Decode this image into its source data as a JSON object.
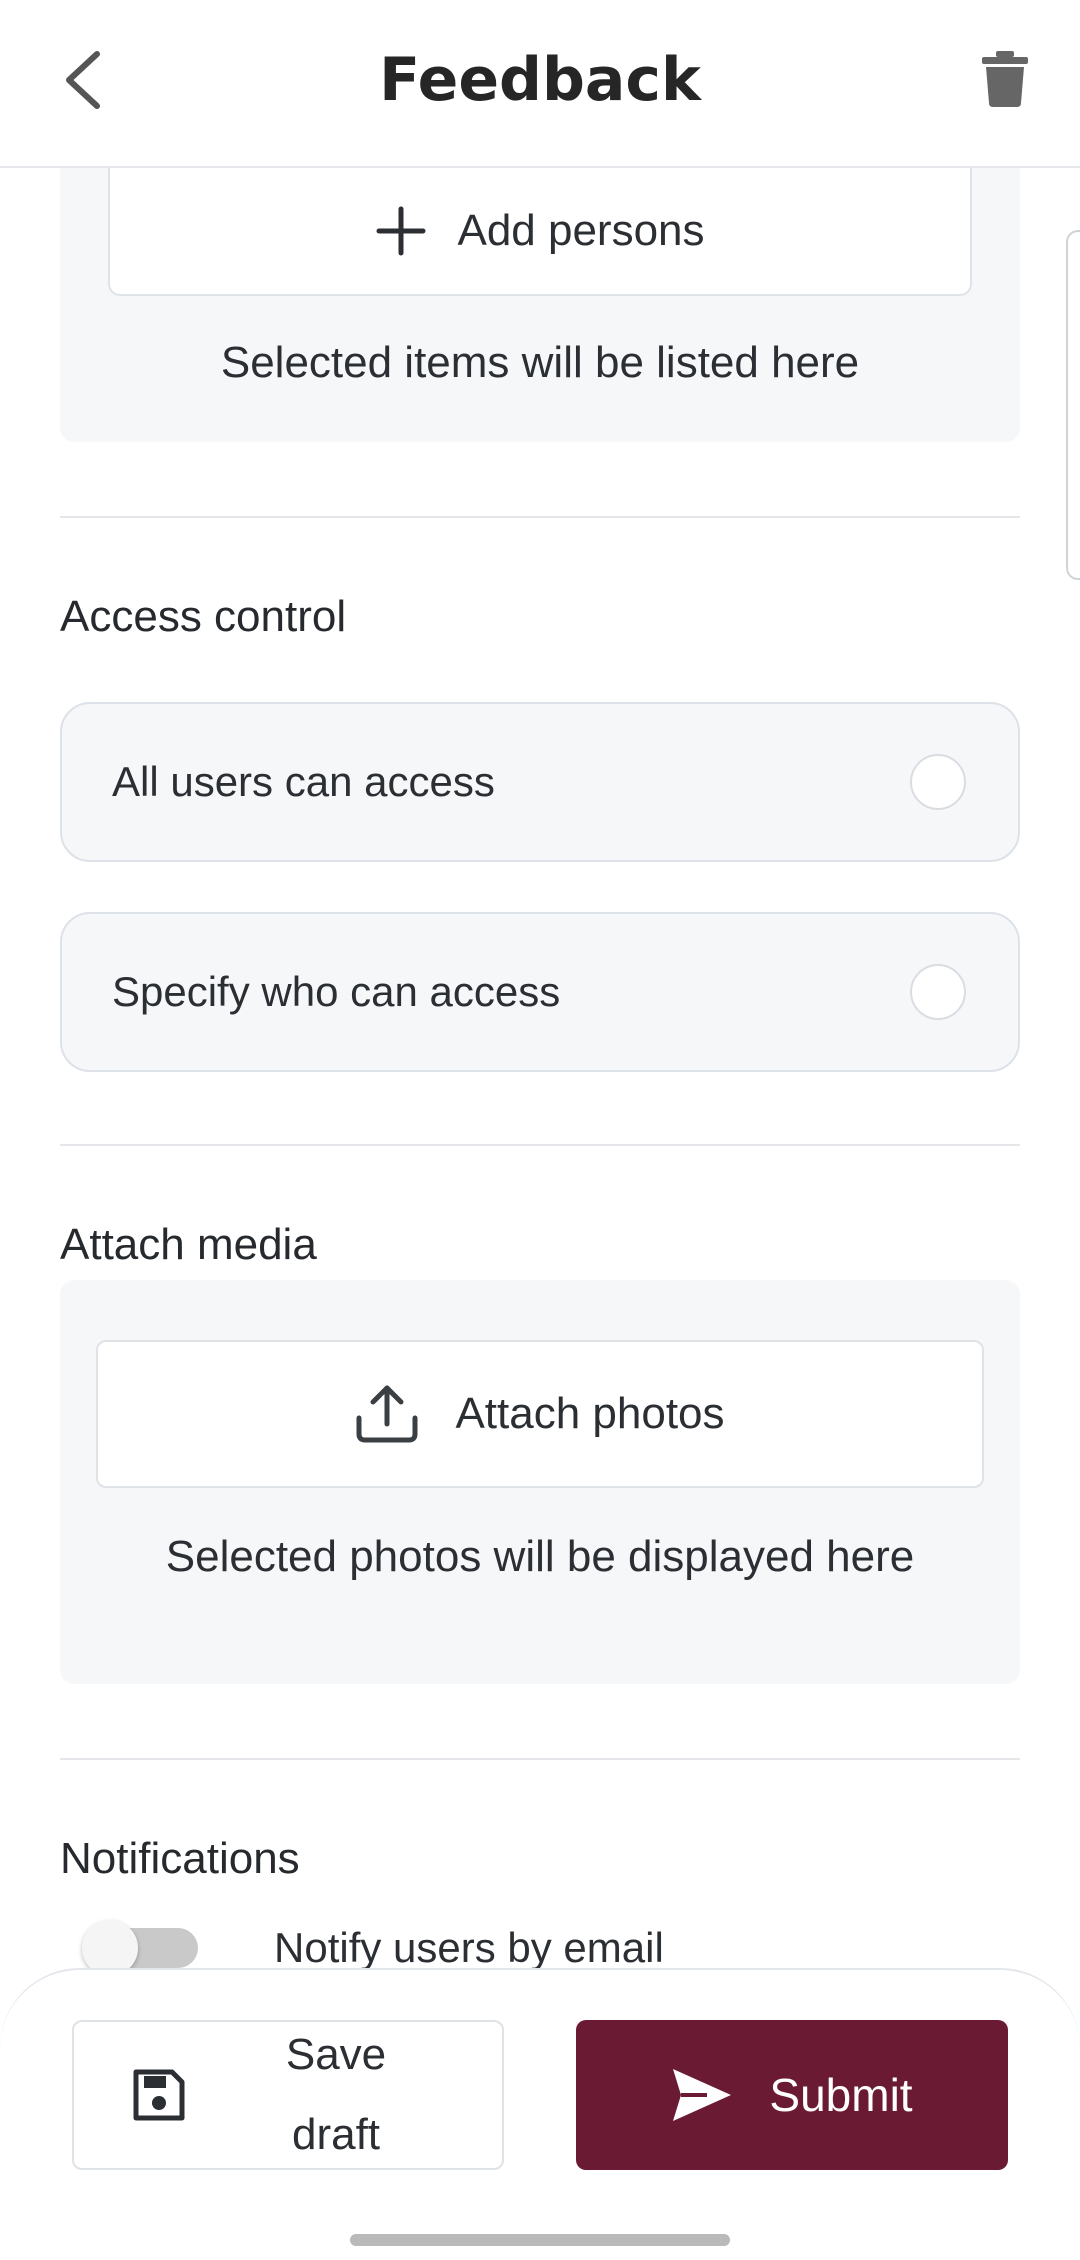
{
  "header": {
    "title": "Feedback"
  },
  "persons": {
    "add_label": "Add persons",
    "placeholder": "Selected items will be listed here"
  },
  "access_control": {
    "title": "Access control",
    "options": [
      {
        "label": "All users can access",
        "selected": false
      },
      {
        "label": "Specify who can access",
        "selected": false
      }
    ]
  },
  "media": {
    "title": "Attach media",
    "attach_label": "Attach photos",
    "placeholder": "Selected photos will be displayed here"
  },
  "notifications": {
    "title": "Notifications",
    "email_label": "Notify users by email",
    "email_enabled": false
  },
  "actions": {
    "save_label": "Save draft",
    "submit_label": "Submit"
  },
  "colors": {
    "primary": "#6b1a33",
    "card_bg": "#f6f7f9"
  }
}
